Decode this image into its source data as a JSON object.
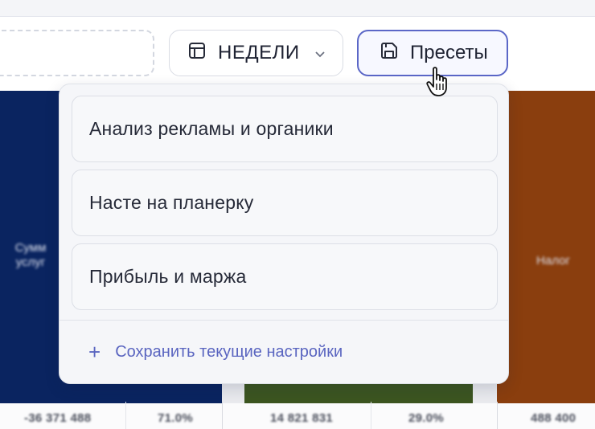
{
  "toolbar": {
    "weeks_label": "НЕДЕЛИ",
    "presets_label": "Пресеты"
  },
  "table": {
    "blue_header": "Сумм\nуслуг",
    "brown_header": "Налог",
    "bottom_values": [
      "-36 371 488",
      "71.0%",
      "14 821 831",
      "29.0%",
      "488 400"
    ]
  },
  "presets_menu": {
    "items": [
      "Анализ рекламы и органики",
      "Насте на планерку",
      "Прибыль и маржа"
    ],
    "save_label": "Сохранить текущие настройки"
  },
  "colors": {
    "accent": "#5b67c7",
    "blue_col": "#0a2460",
    "green_col": "#3c5520",
    "brown_col": "#8a3e0e"
  }
}
